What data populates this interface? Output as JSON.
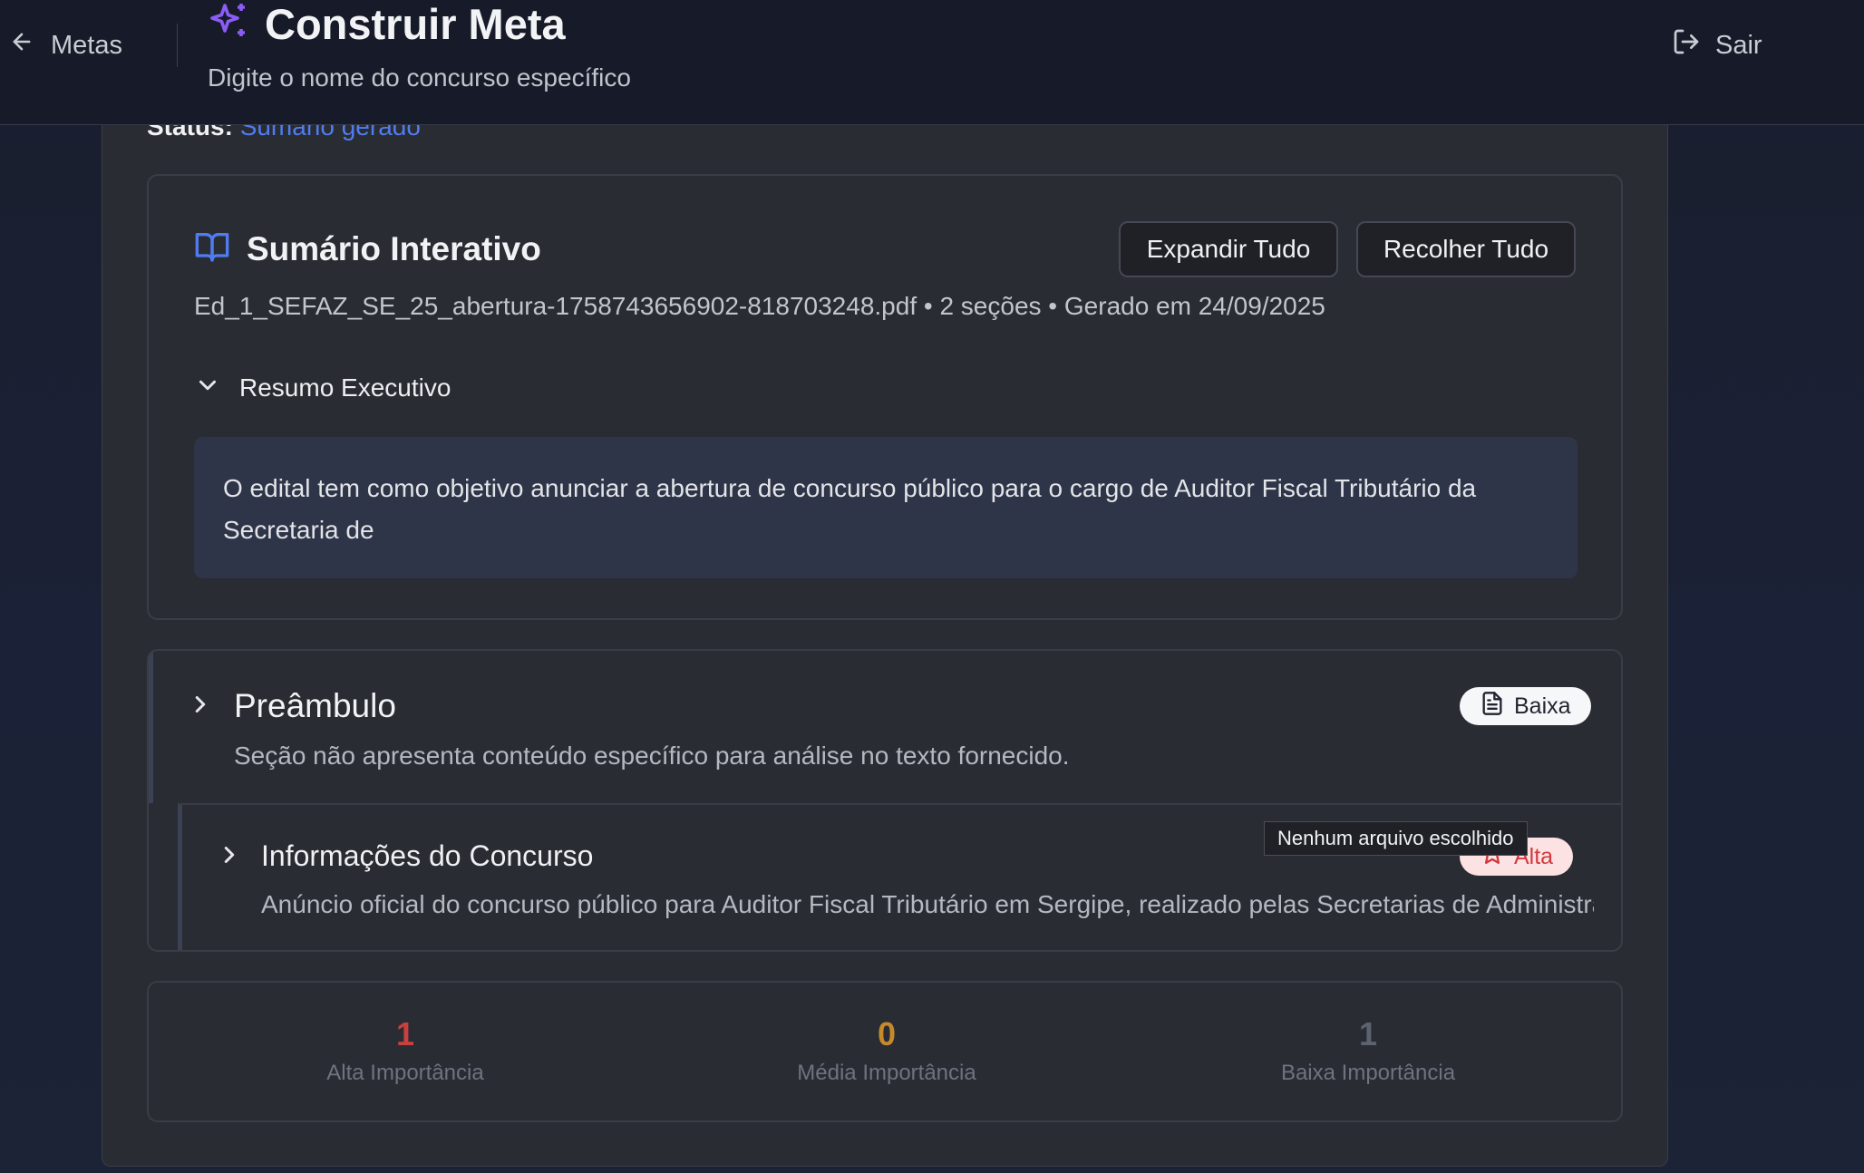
{
  "header": {
    "back_label": "Metas",
    "title": "Construir Meta",
    "subtitle": "Digite o nome do concurso específico",
    "logout_label": "Sair"
  },
  "status": {
    "label": "Status:",
    "value": "Sumário gerado"
  },
  "summary": {
    "title": "Sumário Interativo",
    "expand_label": "Expandir Tudo",
    "collapse_label": "Recolher Tudo",
    "meta": "Ed_1_SEFAZ_SE_25_abertura-1758743656902-818703248.pdf • 2 seções • Gerado em 24/09/2025",
    "executive_label": "Resumo Executivo",
    "executive_text": "O edital tem como objetivo anunciar a abertura de concurso público para o cargo de Auditor Fiscal Tributário da Secretaria de"
  },
  "sections": [
    {
      "title": "Preâmbulo",
      "description": "Seção não apresenta conteúdo específico para análise no texto fornecido.",
      "badge": "Baixa"
    },
    {
      "title": "Informações do Concurso",
      "description": "Anúncio oficial do concurso público para Auditor Fiscal Tributário em Sergipe, realizado pelas Secretarias de Administração e Fazenda",
      "badge": "Alta"
    }
  ],
  "tooltip": "Nenhum arquivo escolhido",
  "stats": {
    "high": {
      "value": "1",
      "label": "Alta Importância"
    },
    "medium": {
      "value": "0",
      "label": "Média Importância"
    },
    "low": {
      "value": "1",
      "label": "Baixa Importância"
    }
  },
  "colors": {
    "accent_purple": "#8b5cf6",
    "link_blue": "#4f7cf0",
    "high": "#c8403f",
    "medium": "#c68a2a",
    "low": "#5d6271"
  }
}
